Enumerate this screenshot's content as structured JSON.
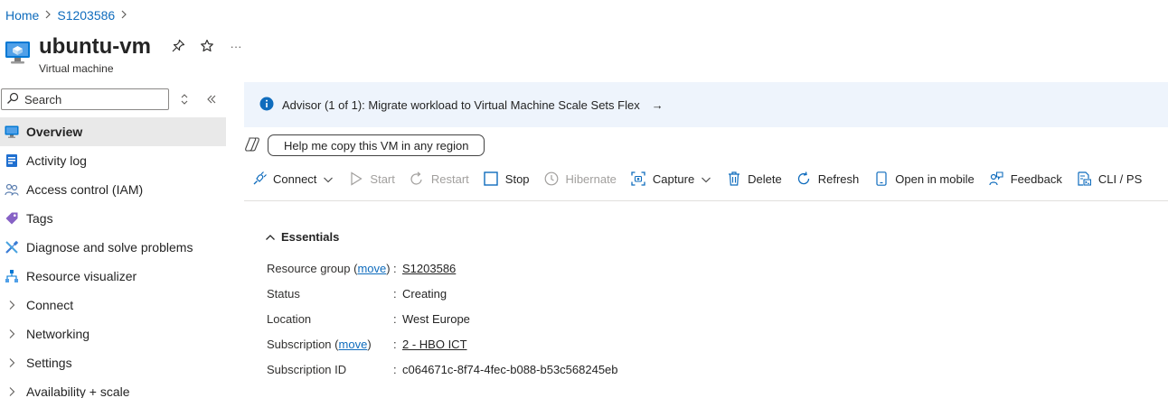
{
  "breadcrumb": {
    "home": "Home",
    "resource": "S1203586"
  },
  "header": {
    "title": "ubuntu-vm",
    "subtitle": "Virtual machine",
    "more": "···"
  },
  "search": {
    "placeholder": "Search"
  },
  "nav": {
    "items": [
      {
        "label": "Overview"
      },
      {
        "label": "Activity log"
      },
      {
        "label": "Access control (IAM)"
      },
      {
        "label": "Tags"
      },
      {
        "label": "Diagnose and solve problems"
      },
      {
        "label": "Resource visualizer"
      },
      {
        "label": "Connect"
      },
      {
        "label": "Networking"
      },
      {
        "label": "Settings"
      },
      {
        "label": "Availability + scale"
      }
    ]
  },
  "advisor": {
    "text": "Advisor (1 of 1): Migrate workload to Virtual Machine Scale Sets Flex",
    "arrow": "→"
  },
  "copilot": {
    "prompt": "Help me copy this VM in any region"
  },
  "toolbar": {
    "connect": "Connect",
    "start": "Start",
    "restart": "Restart",
    "stop": "Stop",
    "hibernate": "Hibernate",
    "capture": "Capture",
    "delete": "Delete",
    "refresh": "Refresh",
    "open_mobile": "Open in mobile",
    "feedback": "Feedback",
    "cli": "CLI / PS"
  },
  "essentials": {
    "heading": "Essentials",
    "move": "move",
    "colon": ":",
    "open_paren": "(",
    "close_paren": ")",
    "resource_group": {
      "label": "Resource group",
      "value": "S1203586"
    },
    "status": {
      "label": "Status",
      "value": "Creating"
    },
    "location": {
      "label": "Location",
      "value": "West Europe"
    },
    "subscription": {
      "label": "Subscription",
      "value": "2 - HBO ICT"
    },
    "subscription_id": {
      "label": "Subscription ID",
      "value": "c064671c-8f74-4fec-b088-b53c568245eb"
    }
  },
  "colors": {
    "link": "#0f6cbd",
    "accent": "#0078d4",
    "advisor_bg": "#eef4fc"
  }
}
